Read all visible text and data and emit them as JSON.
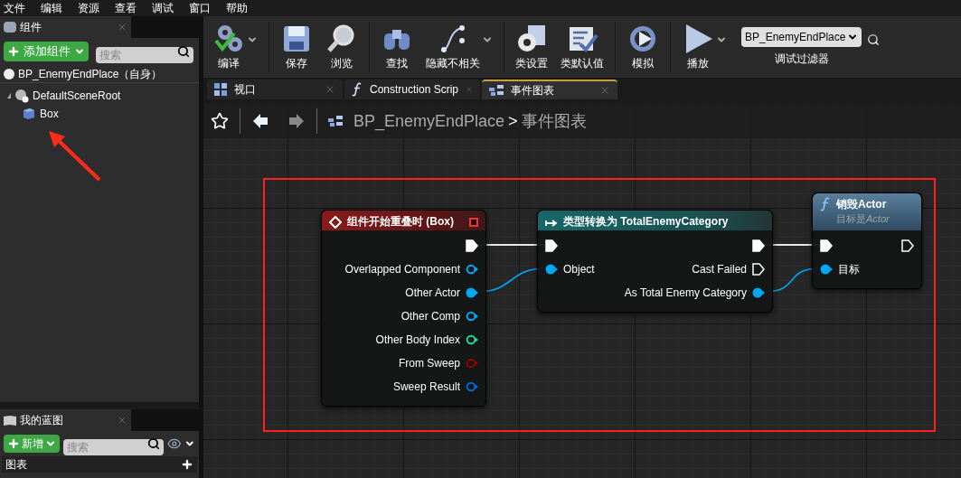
{
  "menu_bar": [
    "文件",
    "编辑",
    "资源",
    "查看",
    "调试",
    "窗口",
    "帮助"
  ],
  "components_panel": {
    "title": "组件",
    "add_button": "添加组件",
    "search": {
      "placeholder": "搜索"
    },
    "self_item": "BP_EnemyEndPlace（自身）",
    "tree": [
      {
        "label": "DefaultSceneRoot",
        "expanded": true,
        "children": [
          {
            "label": "Box"
          }
        ]
      }
    ]
  },
  "my_blueprint_panel": {
    "title": "我的蓝图",
    "add_button": "新增",
    "search": {
      "placeholder": "搜索"
    },
    "section": "图表"
  },
  "toolbar": [
    {
      "label": "编译",
      "dropdown": true
    },
    {
      "label": "保存",
      "dropdown": false
    },
    {
      "label": "浏览",
      "dropdown": false
    },
    {
      "label": "查找",
      "dropdown": false
    },
    {
      "label": "隐藏不相关",
      "dropdown": true
    },
    {
      "label": "类设置",
      "dropdown": false
    },
    {
      "label": "类默认值",
      "dropdown": false
    },
    {
      "label": "模拟",
      "dropdown": false
    },
    {
      "label": "播放",
      "dropdown": true
    }
  ],
  "debug_filter": {
    "value": "BP_EnemyEndPlace",
    "label": "调试过滤器"
  },
  "tabs": [
    {
      "label": "视口",
      "kind": "viewport",
      "selected": false
    },
    {
      "label": "Construction Scrip",
      "kind": "function",
      "selected": false
    },
    {
      "label": "事件图表",
      "kind": "graph",
      "selected": true
    }
  ],
  "breadcrumb": {
    "blueprint": "BP_EnemyEndPlace",
    "separator": ">",
    "graph": "事件图表"
  },
  "nodes": [
    {
      "kind": "event",
      "title": "组件开始重叠时 **(Box)**",
      "rows": [
        {
          "right": {
            "kind": "exec",
            "connected": true
          }
        },
        {
          "right": {
            "kind": "data",
            "label": "Overlapped Component",
            "connected": false,
            "color": "#00a8f4"
          }
        },
        {
          "right": {
            "kind": "data",
            "label": "Other Actor",
            "connected": true,
            "color": "#00a8f4"
          }
        },
        {
          "right": {
            "kind": "data",
            "label": "Other Comp",
            "connected": false,
            "color": "#00a8f4"
          }
        },
        {
          "right": {
            "kind": "data",
            "label": "Other Body Index",
            "connected": false,
            "color": "#1fd7a0"
          }
        },
        {
          "right": {
            "kind": "data",
            "label": "From Sweep",
            "connected": false,
            "color": "#930000"
          }
        },
        {
          "right": {
            "kind": "data",
            "label": "Sweep Result",
            "connected": false,
            "color": "#0066dd"
          }
        }
      ]
    },
    {
      "kind": "cast",
      "title": "类型转换为 **TotalEnemyCategory**",
      "rows": [
        {
          "left": {
            "kind": "exec",
            "connected": true
          },
          "right": {
            "kind": "exec",
            "connected": true
          }
        },
        {
          "left": {
            "kind": "data",
            "label": "Object",
            "connected": true,
            "color": "#00a8f4"
          },
          "right": {
            "kind": "exec",
            "label": "Cast Failed",
            "connected": false
          }
        },
        {
          "right": {
            "kind": "data",
            "label": "As Total Enemy Category",
            "connected": true,
            "color": "#00a8f4"
          }
        }
      ]
    },
    {
      "kind": "function",
      "title": "销毁**Actor**",
      "subtitle": {
        "text": "目标是",
        "target": "Actor"
      },
      "rows": [
        {
          "left": {
            "kind": "exec",
            "connected": true
          },
          "right": {
            "kind": "exec",
            "connected": false
          }
        },
        {
          "left": {
            "kind": "data",
            "label": "目标",
            "connected": true,
            "color": "#00a8f4"
          }
        }
      ]
    }
  ]
}
